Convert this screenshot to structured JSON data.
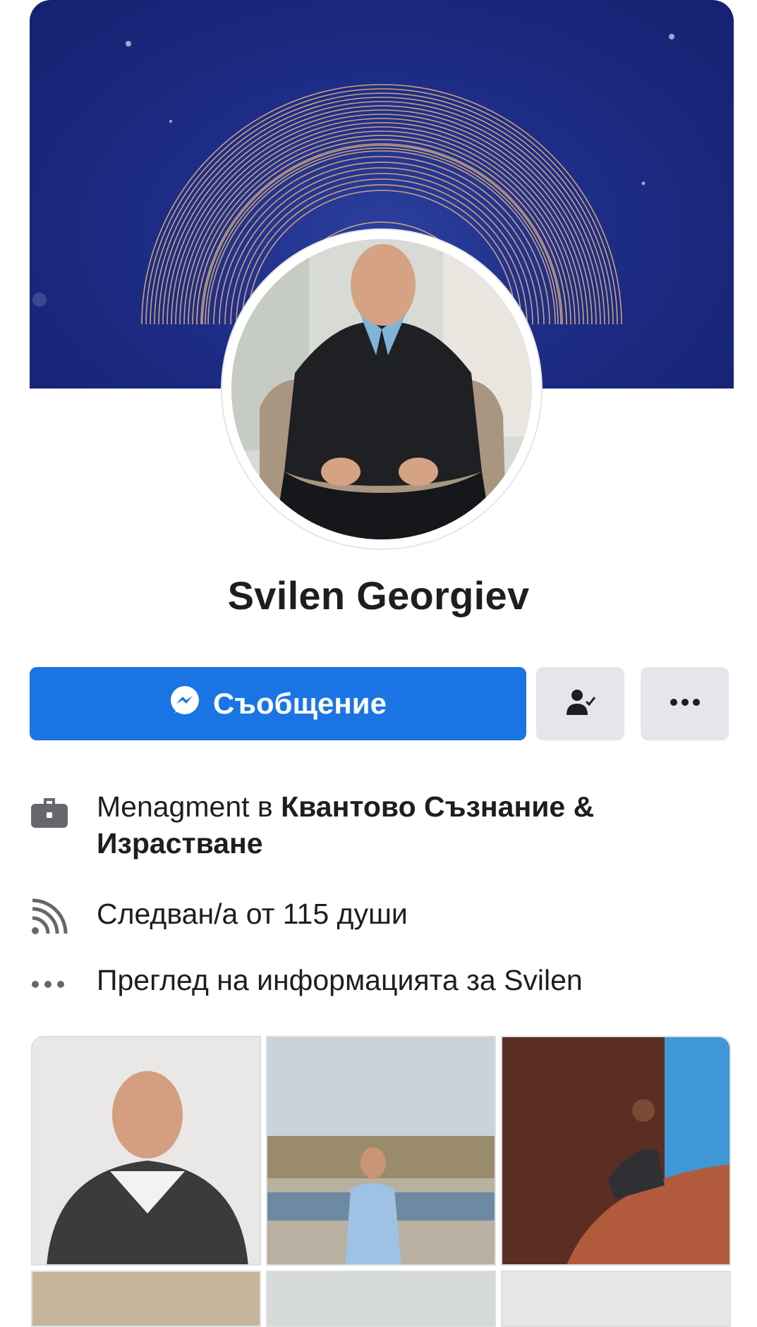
{
  "profile": {
    "name": "Svilen Georgiev"
  },
  "actions": {
    "message_label": "Съобщение",
    "friend_icon": "friend-check-icon",
    "more_icon": "more-icon"
  },
  "info": {
    "work_prefix": "Menagment в ",
    "work_company": "Квантово Съзнание & Израстване",
    "followers": "Следван/а от 115 души",
    "see_about": "Преглед на информацията за Svilen"
  },
  "colors": {
    "primary": "#1b74e4",
    "button_gray": "#e4e6eb",
    "cover_blue": "#1d2c85",
    "ring_gold": "#c9a27a"
  }
}
